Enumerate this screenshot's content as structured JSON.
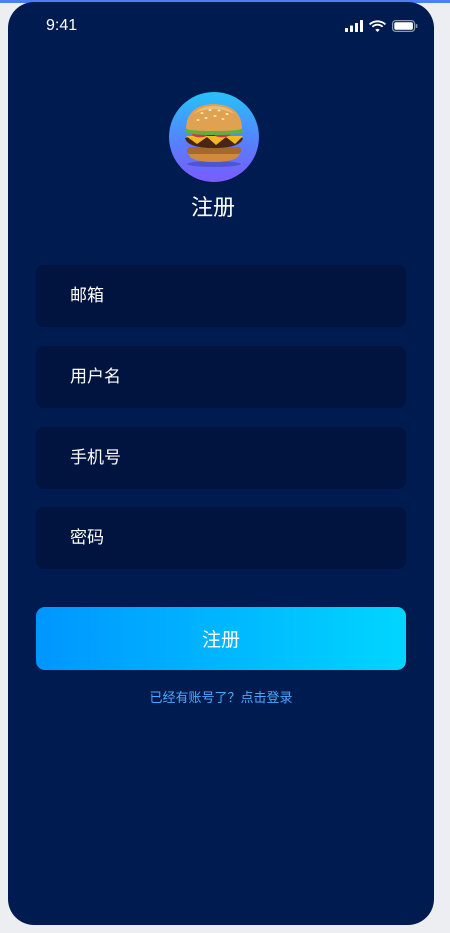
{
  "status_bar": {
    "time": "9:41",
    "icons": [
      "signal-icon",
      "wifi-icon",
      "battery-icon"
    ]
  },
  "header": {
    "avatar": "burger-avatar",
    "title": "注册"
  },
  "form": {
    "fields": [
      {
        "name": "email",
        "placeholder": "邮箱"
      },
      {
        "name": "username",
        "placeholder": "用户名"
      },
      {
        "name": "phone",
        "placeholder": "手机号"
      },
      {
        "name": "password",
        "placeholder": "密码"
      }
    ],
    "submit_label": "注册",
    "login_link": "已经有账号了？点击登录"
  },
  "colors": {
    "background": "#001b50",
    "field_background": "#00143f",
    "button_gradient_start": "#0096ff",
    "button_gradient_end": "#00d6ff",
    "link": "#4aa9ff",
    "text": "#ffffff"
  }
}
